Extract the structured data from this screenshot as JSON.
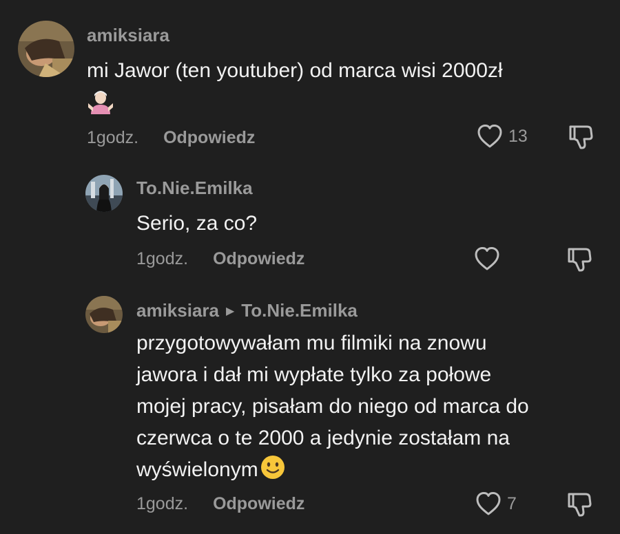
{
  "comments": [
    {
      "username": "amiksiara",
      "text_lines": [
        "mi Jawor (ten youtuber) od marca wisi 2000zł"
      ],
      "emoji": "person-shrugging-emoji",
      "time": "1godz.",
      "reply_label": "Odpowiedz",
      "likes": "13"
    },
    {
      "username": "To.Nie.Emilka",
      "text_lines": [
        "Serio, za co?"
      ],
      "time": "1godz.",
      "reply_label": "Odpowiedz",
      "likes": ""
    },
    {
      "username": "amiksiara",
      "reply_to": "To.Nie.Emilka",
      "text_lines": [
        "przygotowywałam mu filmiki na znowu",
        "jawora i dał mi wypłate tylko za połowe",
        "mojej pracy, pisałam do niego od marca do",
        "czerwca o te 2000 a jedynie zostałam na",
        "wyświelonym"
      ],
      "emoji": "slightly-smiling-face-emoji",
      "time": "1godz.",
      "reply_label": "Odpowiedz",
      "likes": "7"
    }
  ],
  "colors": {
    "background": "#1f1f1f",
    "primary_text": "#f2f2f2",
    "secondary_text": "#9a9a9a"
  }
}
